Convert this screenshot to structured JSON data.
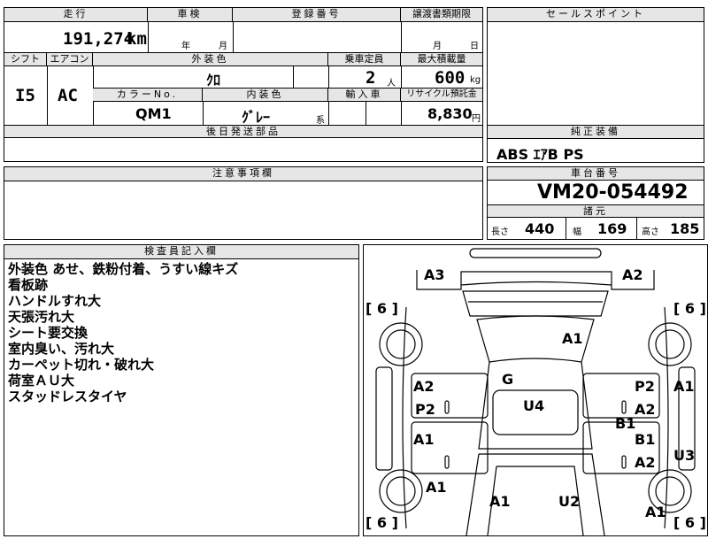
{
  "top": {
    "mileage_header": "走行",
    "mileage_value": "191,274",
    "mileage_unit": "km",
    "inspection_header": "車検",
    "inspection_year": "年",
    "inspection_month": "月",
    "registration_header": "登録番号",
    "transfer_header": "譲渡書類期限",
    "transfer_month": "月",
    "transfer_day": "日",
    "shift_header": "シフト",
    "shift_value": "I5",
    "ac_header": "エアコン",
    "ac_value": "AC",
    "exterior_header": "外装色",
    "exterior_value": "ｸﾛ",
    "capacity_header": "乗車定員",
    "capacity_value": "2",
    "capacity_unit": "人",
    "maxload_header": "最大積載量",
    "maxload_value": "600",
    "maxload_unit": "kg",
    "colorno_header": "カラーNo.",
    "colorno_value": "QM1",
    "interior_header": "内装色",
    "interior_value": "ｸﾞﾚｰ",
    "interior_suffix": "系",
    "import_header": "輸入車",
    "recycle_header": "リサイクル預託金",
    "recycle_value": "8,830",
    "recycle_unit": "円"
  },
  "selling_points_header": "セールスポイント",
  "later_parts_header": "後日発送部品",
  "genuine_equipment_header": "純正装備",
  "genuine_equipment_value": "ABS ｴｱB PS",
  "caution_header": "注意事項欄",
  "chassis_header": "車台番号",
  "chassis_value": "VM20-054492",
  "specs_header": "諸元",
  "specs": {
    "length_label": "長さ",
    "length_value": "440",
    "width_label": "幅",
    "width_value": "169",
    "height_label": "高さ",
    "height_value": "185"
  },
  "inspector_header": "検査員記入欄",
  "inspector_notes": [
    "外装色 あせ、鉄粉付着、うすい線キズ",
    "看板跡",
    "ハンドルすれ大",
    "天張汚れ大",
    "シート要交換",
    "室内臭い、汚れ大",
    "カーペット切れ・破れ大",
    "荷室ＡＵ大",
    "スタッドレスタイヤ"
  ],
  "diagram": {
    "tire_label": "[ 6 ]",
    "codes": [
      "A3",
      "A2",
      "A1",
      "G",
      "A2",
      "P2",
      "U4",
      "P2",
      "A2",
      "A1",
      "B1",
      "A1",
      "B1",
      "A2",
      "U3",
      "A1",
      "A1",
      "U2",
      "A1"
    ]
  }
}
